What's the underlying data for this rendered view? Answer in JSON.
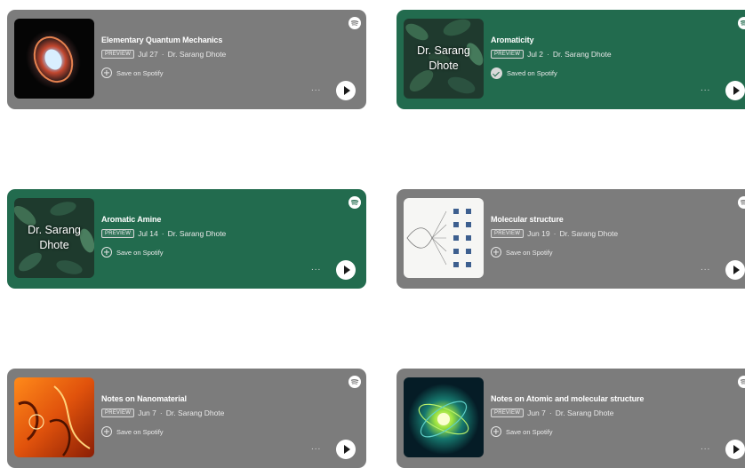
{
  "preview_label": "PREVIEW",
  "save_label": "Save on Spotify",
  "saved_label": "Saved on Spotify",
  "more_label": "...",
  "colors": {
    "green_card": "#226b4e",
    "gray_card": "#7c7c7c"
  },
  "cards": [
    {
      "title": "Elementary Quantum Mechanics",
      "date": "Jul 27",
      "author": "Dr. Sarang Dhote",
      "saved": false,
      "artwork": "quantum-nebula"
    },
    {
      "title": "Aromaticity",
      "date": "Jul 2",
      "author": "Dr. Sarang Dhote",
      "saved": true,
      "artwork_text": [
        "Dr. Sarang",
        "Dhote"
      ]
    },
    {
      "title": "Aromatic Amine",
      "date": "Jul 14",
      "author": "Dr. Sarang Dhote",
      "saved": false,
      "artwork_text": [
        "Dr. Sarang",
        "Dhote"
      ]
    },
    {
      "title": "Molecular structure",
      "date": "Jun 19",
      "author": "Dr. Sarang Dhote",
      "saved": false,
      "artwork": "molecular-diagram"
    },
    {
      "title": "Notes on Nanomaterial",
      "date": "Jun 7",
      "author": "Dr. Sarang Dhote",
      "saved": false,
      "artwork": "orange-abstract"
    },
    {
      "title": "Notes on Atomic and molecular structure",
      "date": "Jun 7",
      "author": "Dr. Sarang Dhote",
      "saved": false,
      "artwork": "atom-glow"
    }
  ]
}
